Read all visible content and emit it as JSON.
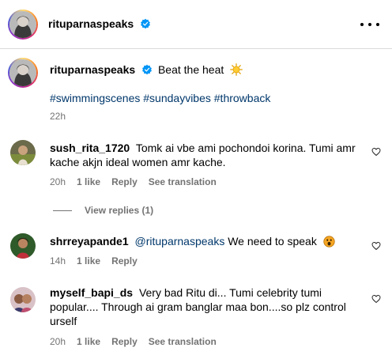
{
  "header": {
    "username": "rituparnaspeaks",
    "verified_icon": "verified-badge-icon",
    "more_icon": "more-options-icon"
  },
  "caption": {
    "username": "rituparnaspeaks",
    "text": "Beat the heat",
    "emoji_icon": "sun-emoji-icon",
    "hashtags": "#swimmingscenes #sundayvibes #throwback",
    "time": "22h"
  },
  "comments": [
    {
      "username": "sush_rita_1720",
      "text": "Tomk ai vbe ami pochondoi korina. Tumi amr kache akjn ideal women amr kache.",
      "time": "20h",
      "likes": "1 like",
      "reply": "Reply",
      "translation": "See translation"
    },
    {
      "username": "shrreyapande1",
      "mention": "@rituparnaspeaks",
      "text": "We need to speak",
      "emoji_icon": "astonished-face-emoji-icon",
      "time": "14h",
      "likes": "1 like",
      "reply": "Reply"
    },
    {
      "username": "myself_bapi_ds",
      "text": "Very bad Ritu di... Tumi celebrity tumi popular.... Through ai gram banglar maa bon....so plz control urself",
      "time": "20h",
      "likes": "1 like",
      "reply": "Reply",
      "translation": "See translation"
    }
  ],
  "view_replies": "View replies (1)",
  "colors": {
    "link": "#00376b",
    "secondary_text": "#737373",
    "verified": "#0095f6",
    "divider": "#dbdbdb"
  }
}
